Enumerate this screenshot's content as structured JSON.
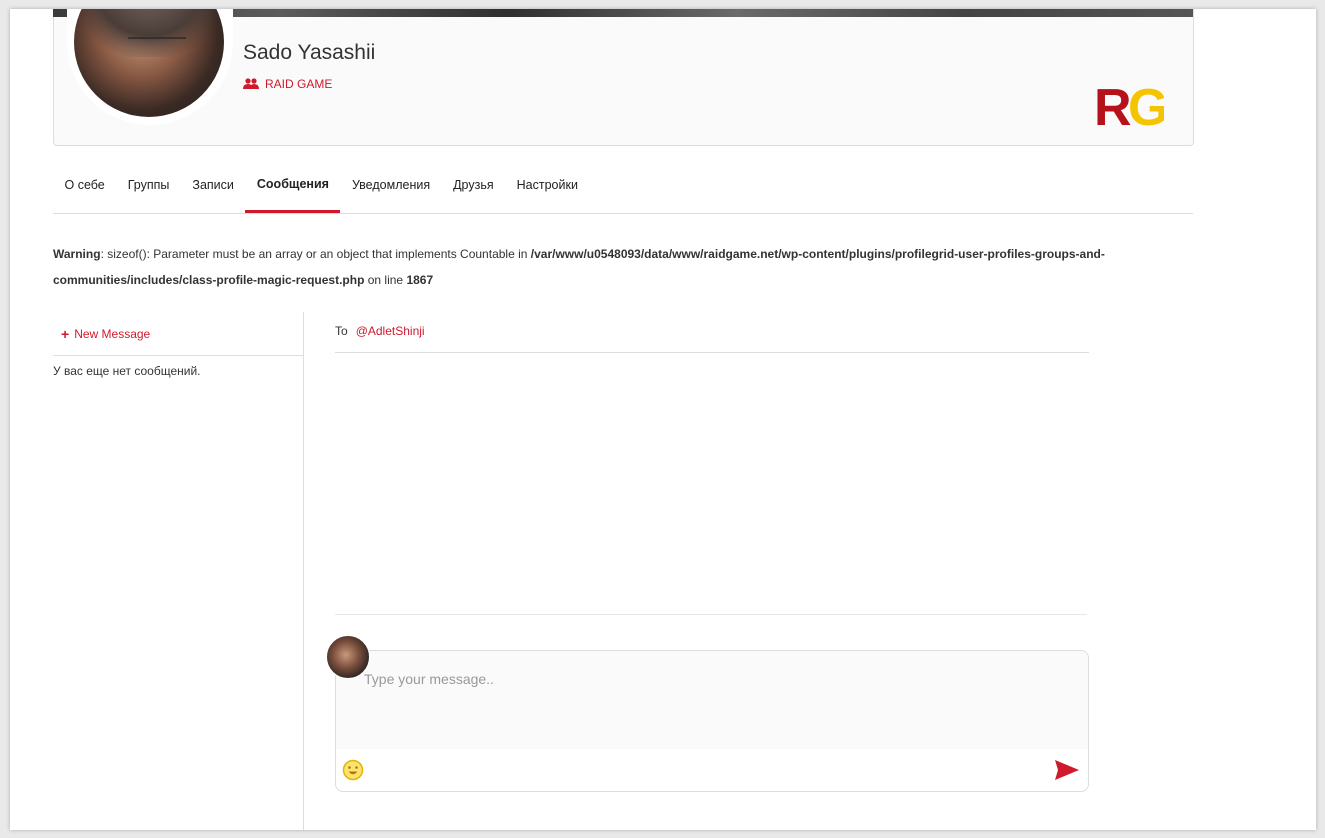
{
  "profile": {
    "name": "Sado Yasashii",
    "group": "RAID GAME",
    "logo_text": "RG"
  },
  "tabs": [
    {
      "label": "О себе"
    },
    {
      "label": "Группы"
    },
    {
      "label": "Записи"
    },
    {
      "label": "Сообщения",
      "active": true
    },
    {
      "label": "Уведомления"
    },
    {
      "label": "Друзья"
    },
    {
      "label": "Настройки"
    }
  ],
  "warning": {
    "label": "Warning",
    "text1": ": sizeof(): Parameter must be an array or an object that implements Countable in ",
    "path": "/var/www/u0548093/data/www/raidgame.net/wp-content/plugins/profilegrid-user-profiles-groups-and-communities/includes/class-profile-magic-request.php",
    "text2": " on line ",
    "line": "1867"
  },
  "sidebar": {
    "new_message": "New Message",
    "empty_text": "У вас еще нет сообщений."
  },
  "conversation": {
    "to_label": "To",
    "to_handle": "@AdletShinji"
  },
  "composer": {
    "placeholder": "Type your message.."
  },
  "colors": {
    "accent": "#d0192c",
    "logo_red": "#b5121b",
    "logo_yellow": "#f5c400"
  }
}
